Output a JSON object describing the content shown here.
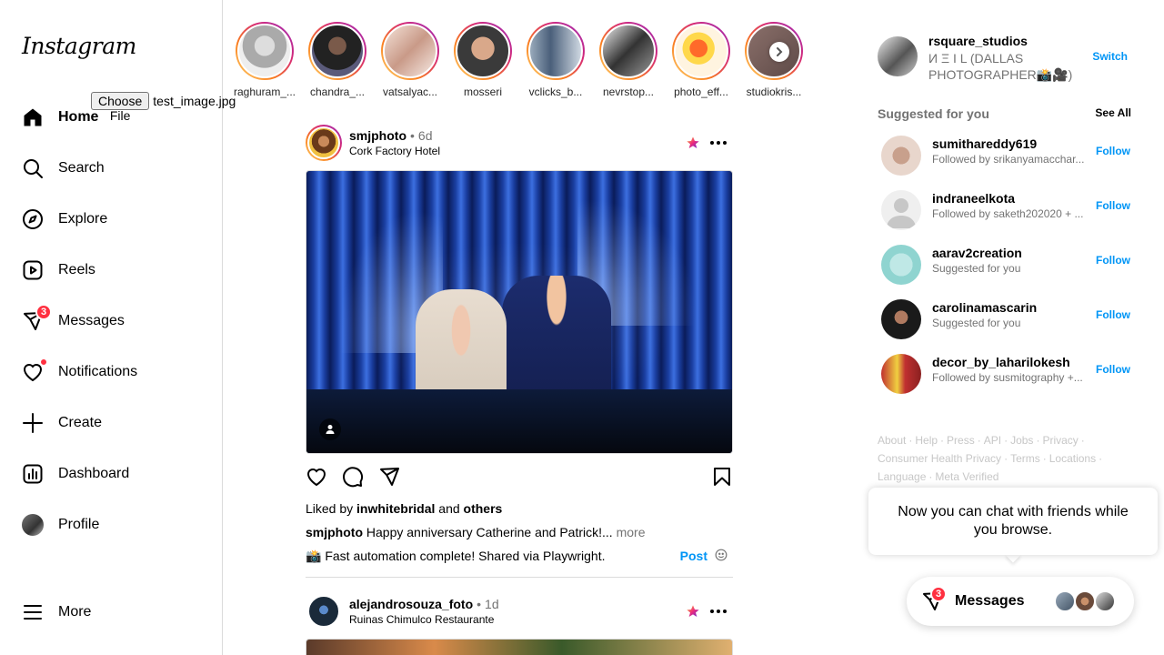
{
  "app": {
    "logo": "Instagram"
  },
  "file_input": {
    "button_label": "Choose File",
    "file_name": "test_image.jpg"
  },
  "nav": {
    "items": [
      {
        "label": "Home",
        "icon": "home-icon",
        "active": true
      },
      {
        "label": "Search",
        "icon": "search-icon"
      },
      {
        "label": "Explore",
        "icon": "compass-icon"
      },
      {
        "label": "Reels",
        "icon": "reels-icon"
      },
      {
        "label": "Messages",
        "icon": "messenger-icon",
        "badge": "3"
      },
      {
        "label": "Notifications",
        "icon": "heart-icon",
        "dot": true
      },
      {
        "label": "Create",
        "icon": "plus-icon"
      },
      {
        "label": "Dashboard",
        "icon": "dashboard-icon"
      },
      {
        "label": "Profile",
        "icon": "avatar"
      }
    ],
    "more_label": "More"
  },
  "stories": [
    {
      "name": "raghuram_..."
    },
    {
      "name": "chandra_..."
    },
    {
      "name": "vatsalyac..."
    },
    {
      "name": "mosseri"
    },
    {
      "name": "vclicks_b..."
    },
    {
      "name": "nevrstop..."
    },
    {
      "name": "photo_eff..."
    },
    {
      "name": "studiokris..."
    }
  ],
  "posts": [
    {
      "user": "smjphoto",
      "time": "6d",
      "location": "Cork Factory Hotel",
      "liked_by": "inwhitebridal",
      "liked_and": "and",
      "liked_others": "others",
      "liked_prefix": "Liked by",
      "caption_user": "smjphoto",
      "caption_text": "Happy anniversary Catherine and Patrick!...",
      "caption_more": "more",
      "comment_text": "📸 Fast automation complete! Shared via Playwright.",
      "post_label": "Post"
    },
    {
      "user": "alejandrosouza_foto",
      "time": "1d",
      "location": "Ruinas Chimulco Restaurante"
    }
  ],
  "right": {
    "me": {
      "username": "rsquare_studios",
      "full_name": "И Ξ I L (DALLAS PHOTOGRAPHER📸🎥)",
      "switch_label": "Switch"
    },
    "suggested_title": "Suggested for you",
    "see_all": "See All",
    "suggestions": [
      {
        "username": "sumithareddy619",
        "sub": "Followed by srikanyamacchar...",
        "action": "Follow"
      },
      {
        "username": "indraneelkota",
        "sub": "Followed by saketh202020 + ...",
        "action": "Follow"
      },
      {
        "username": "aarav2creation",
        "sub": "Suggested for you",
        "action": "Follow"
      },
      {
        "username": "carolinamascarin",
        "sub": "Suggested for you",
        "action": "Follow"
      },
      {
        "username": "decor_by_laharilokesh",
        "sub": "Followed by susmitography +...",
        "action": "Follow"
      }
    ],
    "footer_links": [
      "About",
      "Help",
      "Press",
      "API",
      "Jobs",
      "Privacy",
      "Consumer Health Privacy",
      "Terms",
      "Locations",
      "Language",
      "Meta Verified"
    ]
  },
  "chat": {
    "tooltip": "Now you can chat with friends while you browse.",
    "pill_label": "Messages",
    "badge": "3"
  },
  "colors": {
    "accent": "#0095f6",
    "badge": "#ff3040",
    "muted": "#737373",
    "border": "#dbdbdb"
  }
}
